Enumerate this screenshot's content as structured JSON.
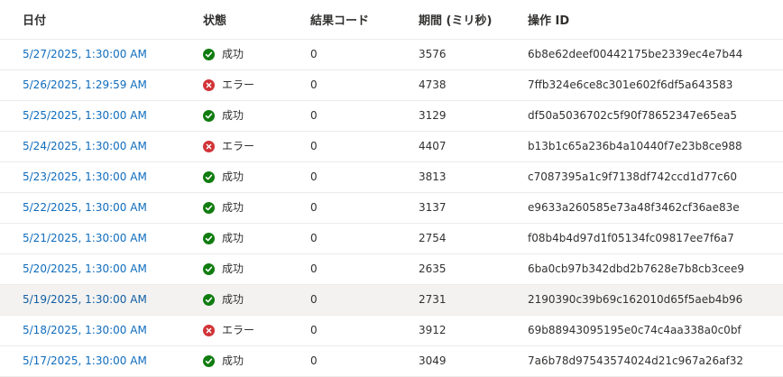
{
  "columns": {
    "date": "日付",
    "status": "状態",
    "result_code": "結果コード",
    "duration": "期間 (ミリ秒)",
    "operation_id": "操作 ID"
  },
  "colors": {
    "success": "#107c10",
    "error": "#d13438",
    "link": "#0f6cbd",
    "hover_row": "#f3f2f1"
  },
  "rows": [
    {
      "date": "5/27/2025, 1:30:00 AM",
      "status": "success",
      "status_label": "成功",
      "code": "0",
      "duration": "3576",
      "op_id": "6b8e62deef00442175be2339ec4e7b44"
    },
    {
      "date": "5/26/2025, 1:29:59 AM",
      "status": "error",
      "status_label": "エラー",
      "code": "0",
      "duration": "4738",
      "op_id": "7ffb324e6ce8c301e602f6df5a643583"
    },
    {
      "date": "5/25/2025, 1:30:00 AM",
      "status": "success",
      "status_label": "成功",
      "code": "0",
      "duration": "3129",
      "op_id": "df50a5036702c5f90f78652347e65ea5"
    },
    {
      "date": "5/24/2025, 1:30:00 AM",
      "status": "error",
      "status_label": "エラー",
      "code": "0",
      "duration": "4407",
      "op_id": "b13b1c65a236b4a10440f7e23b8ce988"
    },
    {
      "date": "5/23/2025, 1:30:00 AM",
      "status": "success",
      "status_label": "成功",
      "code": "0",
      "duration": "3813",
      "op_id": "c7087395a1c9f7138df742ccd1d77c60"
    },
    {
      "date": "5/22/2025, 1:30:00 AM",
      "status": "success",
      "status_label": "成功",
      "code": "0",
      "duration": "3137",
      "op_id": "e9633a260585e73a48f3462cf36ae83e"
    },
    {
      "date": "5/21/2025, 1:30:00 AM",
      "status": "success",
      "status_label": "成功",
      "code": "0",
      "duration": "2754",
      "op_id": "f08b4b4d97d1f05134fc09817ee7f6a7"
    },
    {
      "date": "5/20/2025, 1:30:00 AM",
      "status": "success",
      "status_label": "成功",
      "code": "0",
      "duration": "2635",
      "op_id": "6ba0cb97b342dbd2b7628e7b8cb3cee9"
    },
    {
      "date": "5/19/2025, 1:30:00 AM",
      "status": "success",
      "status_label": "成功",
      "code": "0",
      "duration": "2731",
      "op_id": "2190390c39b69c162010d65f5aeb4b96",
      "hovered": true
    },
    {
      "date": "5/18/2025, 1:30:00 AM",
      "status": "error",
      "status_label": "エラー",
      "code": "0",
      "duration": "3912",
      "op_id": "69b88943095195e0c74c4aa338a0c0bf"
    },
    {
      "date": "5/17/2025, 1:30:00 AM",
      "status": "success",
      "status_label": "成功",
      "code": "0",
      "duration": "3049",
      "op_id": "7a6b78d97543574024d21c967a26af32"
    }
  ]
}
